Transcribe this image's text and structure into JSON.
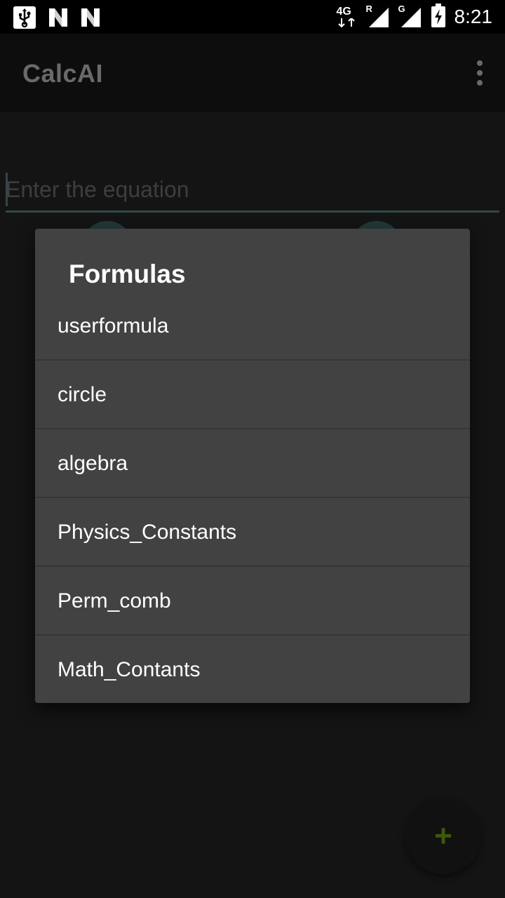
{
  "status_bar": {
    "time": "8:21",
    "network_1": "4G",
    "network_1_roaming": "R",
    "network_2": "G",
    "left_icons": [
      "usb-icon",
      "n-notification-icon",
      "n-notification-icon"
    ]
  },
  "app_bar": {
    "title": "CalcAI",
    "overflow_icon": "more-vert-icon"
  },
  "equation": {
    "placeholder": "Enter the equation",
    "value": ""
  },
  "dialog": {
    "title": "Formulas",
    "items": [
      {
        "label": "userformula"
      },
      {
        "label": "circle"
      },
      {
        "label": "algebra"
      },
      {
        "label": "Physics_Constants"
      },
      {
        "label": "Perm_comb"
      },
      {
        "label": "Math_Contants"
      }
    ]
  },
  "fab": {
    "icon": "plus-icon",
    "symbol": "+"
  },
  "colors": {
    "dialog_bg": "#424242",
    "scrim_bg": "#141414",
    "input_underline": "#2f4848",
    "fab_plus": "#3b5a0a"
  }
}
